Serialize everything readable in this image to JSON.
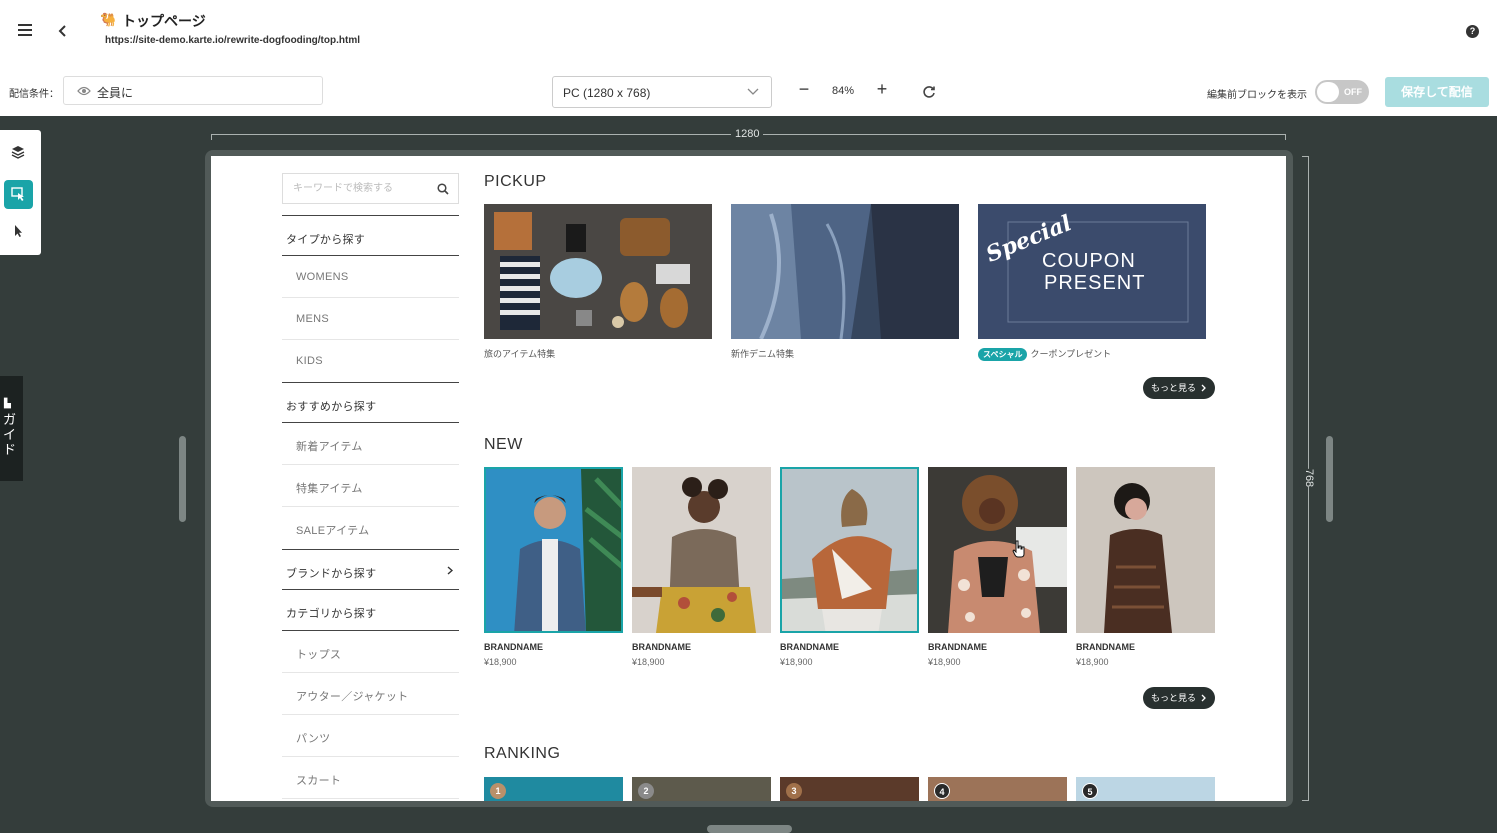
{
  "header": {
    "menu_icon": "hamburger-icon",
    "back_icon": "chevron-left-icon",
    "page_icon": "🐫",
    "title": "トップページ",
    "url": "https://site-demo.karte.io/rewrite-dogfooding/top.html",
    "help_icon": "help-icon",
    "help_glyph": "?"
  },
  "toolbar": {
    "condition_label": "配信条件：",
    "condition_value": "全員に",
    "device": "PC (1280 x 768)",
    "zoom_minus": "−",
    "zoom": "84%",
    "zoom_plus": "+",
    "show_before_label": "編集前ブロックを表示",
    "toggle_text": "OFF",
    "save_label": "保存して配信"
  },
  "workspace": {
    "width_ruler": "1280",
    "height_ruler": "768",
    "guide_label": "ガイド"
  },
  "site": {
    "search_placeholder": "キーワードで検索する",
    "nav": [
      {
        "label": "タイプから探す",
        "type": "head"
      },
      {
        "label": "WOMENS",
        "type": "item"
      },
      {
        "label": "MENS",
        "type": "item"
      },
      {
        "label": "KIDS",
        "type": "item"
      },
      {
        "label": "おすすめから探す",
        "type": "head"
      },
      {
        "label": "新着アイテム",
        "type": "item"
      },
      {
        "label": "特集アイテム",
        "type": "item"
      },
      {
        "label": "SALEアイテム",
        "type": "item"
      },
      {
        "label": "ブランドから探す",
        "type": "head"
      },
      {
        "label": "カテゴリから探す",
        "type": "head"
      },
      {
        "label": "トップス",
        "type": "item"
      },
      {
        "label": "アウター／ジャケット",
        "type": "item"
      },
      {
        "label": "パンツ",
        "type": "item"
      },
      {
        "label": "スカート",
        "type": "item"
      }
    ],
    "pickup": {
      "title": "PICKUP",
      "cards": [
        {
          "caption": "旅のアイテム特集"
        },
        {
          "caption": "新作デニム特集"
        },
        {
          "badge": "スペシャル",
          "caption": "クーポンプレゼント",
          "banner_script": "Special",
          "banner_line1": "COUPON",
          "banner_line2": "PRESENT"
        }
      ],
      "more_label": "もっと見る"
    },
    "new": {
      "title": "NEW",
      "products": [
        {
          "brand": "BRANDNAME",
          "price": "¥18,900"
        },
        {
          "brand": "BRANDNAME",
          "price": "¥18,900"
        },
        {
          "brand": "BRANDNAME",
          "price": "¥18,900"
        },
        {
          "brand": "BRANDNAME",
          "price": "¥18,900"
        },
        {
          "brand": "BRANDNAME",
          "price": "¥18,900"
        }
      ],
      "more_label": "もっと見る"
    },
    "ranking": {
      "title": "RANKING",
      "ranks": [
        "1",
        "2",
        "3",
        "4",
        "5"
      ]
    }
  },
  "colors": {
    "accent": "#1aa4a8",
    "workspace_bg": "#343d3b",
    "save_disabled": "#a9dde0"
  }
}
